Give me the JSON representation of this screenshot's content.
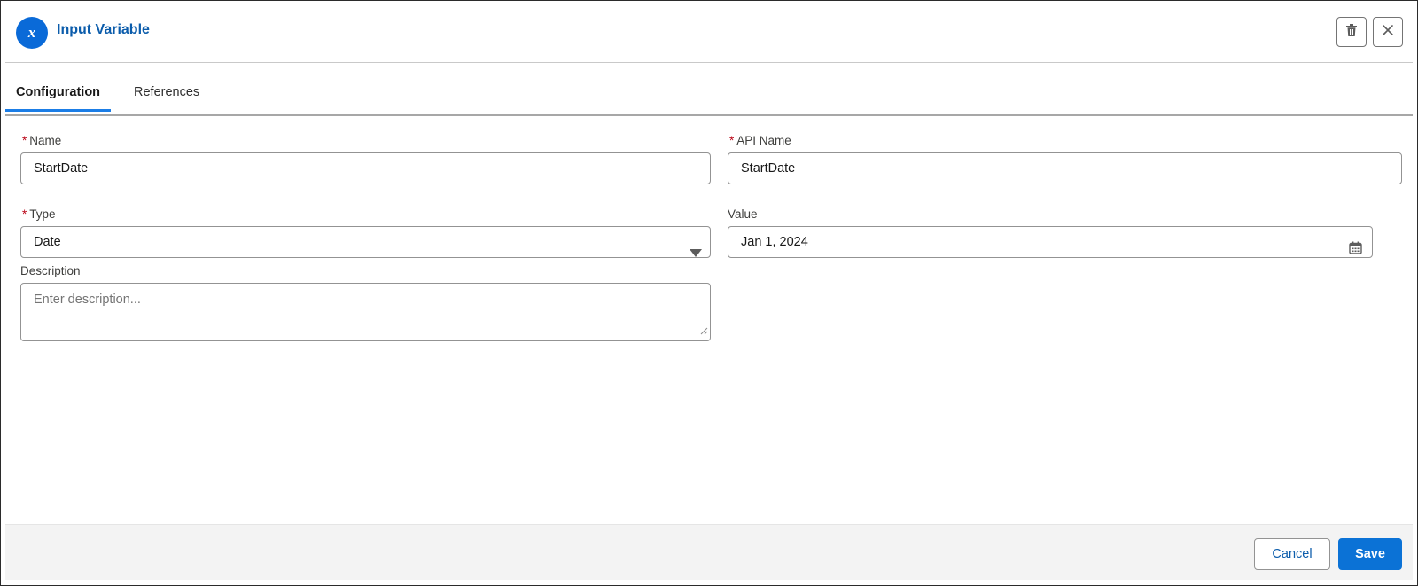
{
  "header": {
    "title": "Input Variable",
    "icon": "variable-x-icon",
    "delete_icon": "trash-icon",
    "close_icon": "close-icon"
  },
  "tabs": [
    {
      "label": "Configuration",
      "active": true
    },
    {
      "label": "References",
      "active": false
    }
  ],
  "form": {
    "required_marker": "*",
    "name": {
      "label": "Name",
      "value": "StartDate"
    },
    "api_name": {
      "label": "API Name",
      "value": "StartDate"
    },
    "type": {
      "label": "Type",
      "value": "Date"
    },
    "value": {
      "label": "Value",
      "value": "Jan 1, 2024"
    },
    "description": {
      "label": "Description",
      "placeholder": "Enter description..."
    }
  },
  "footer": {
    "cancel_label": "Cancel",
    "save_label": "Save"
  },
  "colors": {
    "accent": "#0b72d6",
    "title": "#0b5cab",
    "required": "#ba0517"
  }
}
